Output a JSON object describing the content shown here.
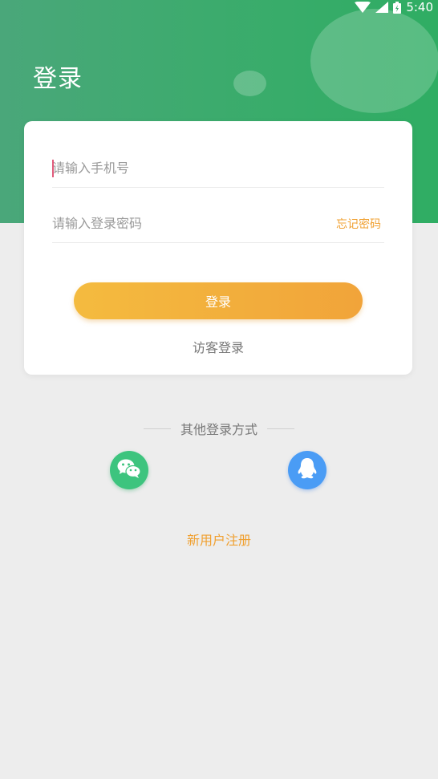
{
  "status_bar": {
    "time": "5:40",
    "icons": [
      "wifi-icon",
      "signal-icon",
      "battery-icon"
    ]
  },
  "header": {
    "title": "登录"
  },
  "login_form": {
    "phone_placeholder": "请输入手机号",
    "password_placeholder": "请输入登录密码",
    "forgot_password": "忘记密码",
    "login_button": "登录",
    "guest_login": "访客登录"
  },
  "other_login": {
    "label": "其他登录方式",
    "methods": [
      {
        "name": "wechat",
        "icon": "wechat-icon"
      },
      {
        "name": "qq",
        "icon": "qq-icon"
      }
    ]
  },
  "register": {
    "label": "新用户注册"
  },
  "colors": {
    "header_green": "#3dab6e",
    "accent_orange": "#f0a030",
    "wechat_green": "#3dc47e",
    "qq_blue": "#4a9cf5",
    "background": "#ededed"
  }
}
